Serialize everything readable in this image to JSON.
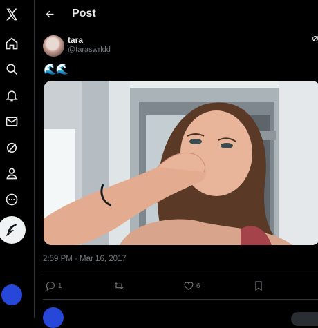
{
  "header": {
    "title": "Post"
  },
  "tweet": {
    "display_name": "tara",
    "handle": "@taraswrldd",
    "text": "🌊🌊",
    "timestamp": "2:59 PM · Mar 16, 2017",
    "reply_count": "1",
    "repost_count": "",
    "like_count": "6"
  },
  "colors": {
    "background": "#000000",
    "text": "#e7e9ea",
    "muted": "#71767b",
    "accent_avatar": "#2747d8",
    "divider": "#2f3336"
  },
  "sidebar": {
    "items": [
      {
        "icon": "x-logo-icon"
      },
      {
        "icon": "home-icon"
      },
      {
        "icon": "search-icon"
      },
      {
        "icon": "bell-icon"
      },
      {
        "icon": "mail-icon"
      },
      {
        "icon": "grok-icon"
      },
      {
        "icon": "profile-icon"
      },
      {
        "icon": "more-circle-icon"
      },
      {
        "icon": "compose-icon"
      }
    ]
  }
}
